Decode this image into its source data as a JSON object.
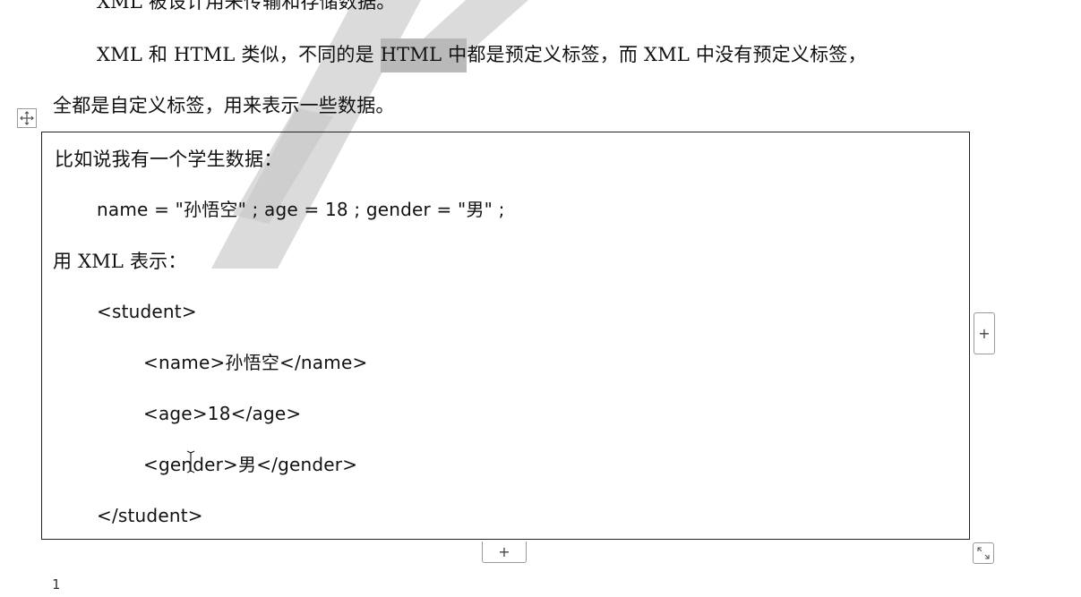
{
  "document": {
    "line_top_partial": "XML 被设计用来传输和存储数据。",
    "para2_part1": "XML 和 HTML 类似，不同的是 ",
    "para2_highlight": "HTML 中",
    "para2_part2": "都是预定义标签，而 XML 中没有预定义标签，",
    "para2_line2": "全都是自定义标签，用来表示一些数据。"
  },
  "table": {
    "lines": [
      "比如说我有一个学生数据：",
      "name = \"孙悟空\" ; age = 18 ; gender = \"男\" ;",
      "用 XML 表示：",
      "<student>",
      "<name>孙悟空</name>",
      "<age>18</age>",
      "<gender>男</gender>",
      "</student>"
    ]
  },
  "controls": {
    "add_column_label": "+",
    "add_row_label": "+"
  },
  "footer": {
    "page_number": "1"
  },
  "icons": {
    "move": "move-arrows-icon",
    "resize": "resize-diagonal-icon",
    "watermark": "watermark-letters",
    "caret": "text-i-beam-cursor-icon"
  },
  "colors": {
    "highlight": "#b9b9b9",
    "watermark": "#c8c8c8",
    "border": "#222222"
  }
}
